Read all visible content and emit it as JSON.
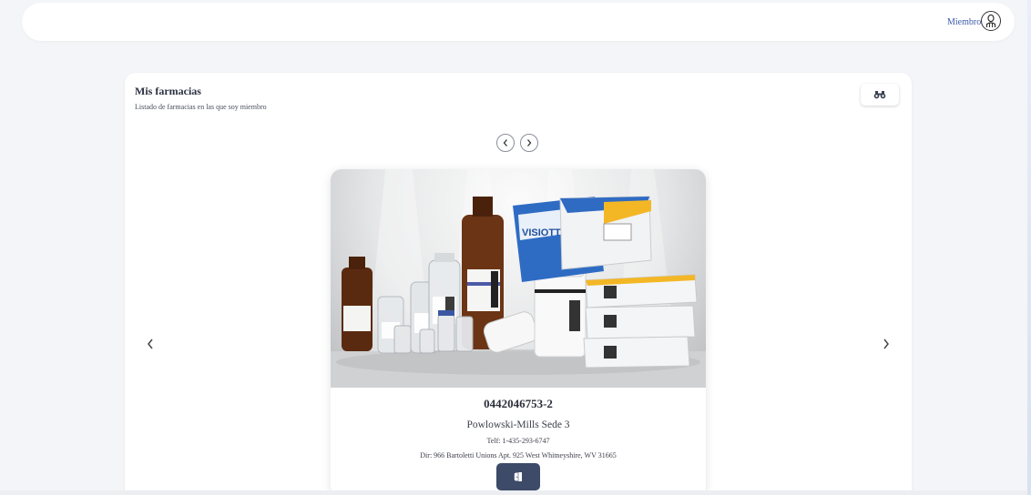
{
  "header": {
    "member_label": "Miembro",
    "avatar_icon": "user-circle-icon"
  },
  "section": {
    "title": "Mis farmacias",
    "subtitle": "Listado de farmacias en las que soy miembro",
    "search_icon": "binoculars-icon"
  },
  "carousel": {
    "prev_icon": "chevron-left-icon",
    "next_icon": "chevron-right-icon"
  },
  "pharmacy": {
    "ruc": "0442046753-2",
    "name": "Powlowski-Mills Sede 3",
    "phone": "Telf: 1-435-293-6747",
    "address": "Dir: 966 Bartoletti Unions Apt. 925 West Whitneyshire, WV 31665",
    "enter_icon": "door-enter-icon",
    "photo_brand": "VISIOTT"
  },
  "colors": {
    "accent": "#3d4a68",
    "link": "#3a5aa8",
    "page_bg": "#f4f5f8"
  }
}
